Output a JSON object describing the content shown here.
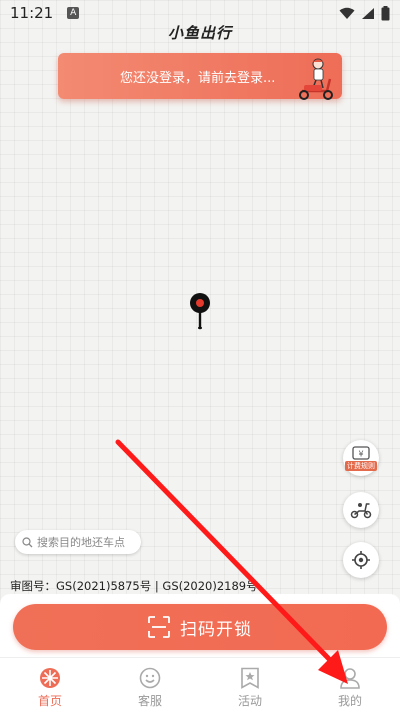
{
  "status_bar": {
    "time": "11:21",
    "notification_glyph": "A"
  },
  "app": {
    "title": "小鱼出行"
  },
  "banner": {
    "text": "您还没登录，请前去登录..."
  },
  "side_buttons": {
    "fee_label": "计费规则"
  },
  "search": {
    "placeholder": "搜索目的地还车点"
  },
  "map": {
    "license": "审图号：GS(2021)5875号 | GS(2020)2189号"
  },
  "main_action": {
    "label": "扫码开锁"
  },
  "tabs": [
    {
      "label": "首页",
      "icon": "flower-icon",
      "active": true
    },
    {
      "label": "客服",
      "icon": "smile-icon",
      "active": false
    },
    {
      "label": "活动",
      "icon": "star-bookmark-icon",
      "active": false
    },
    {
      "label": "我的",
      "icon": "person-icon",
      "active": false
    }
  ],
  "colors": {
    "accent": "#ee6d57",
    "annotation_arrow": "#ff1a1a"
  }
}
